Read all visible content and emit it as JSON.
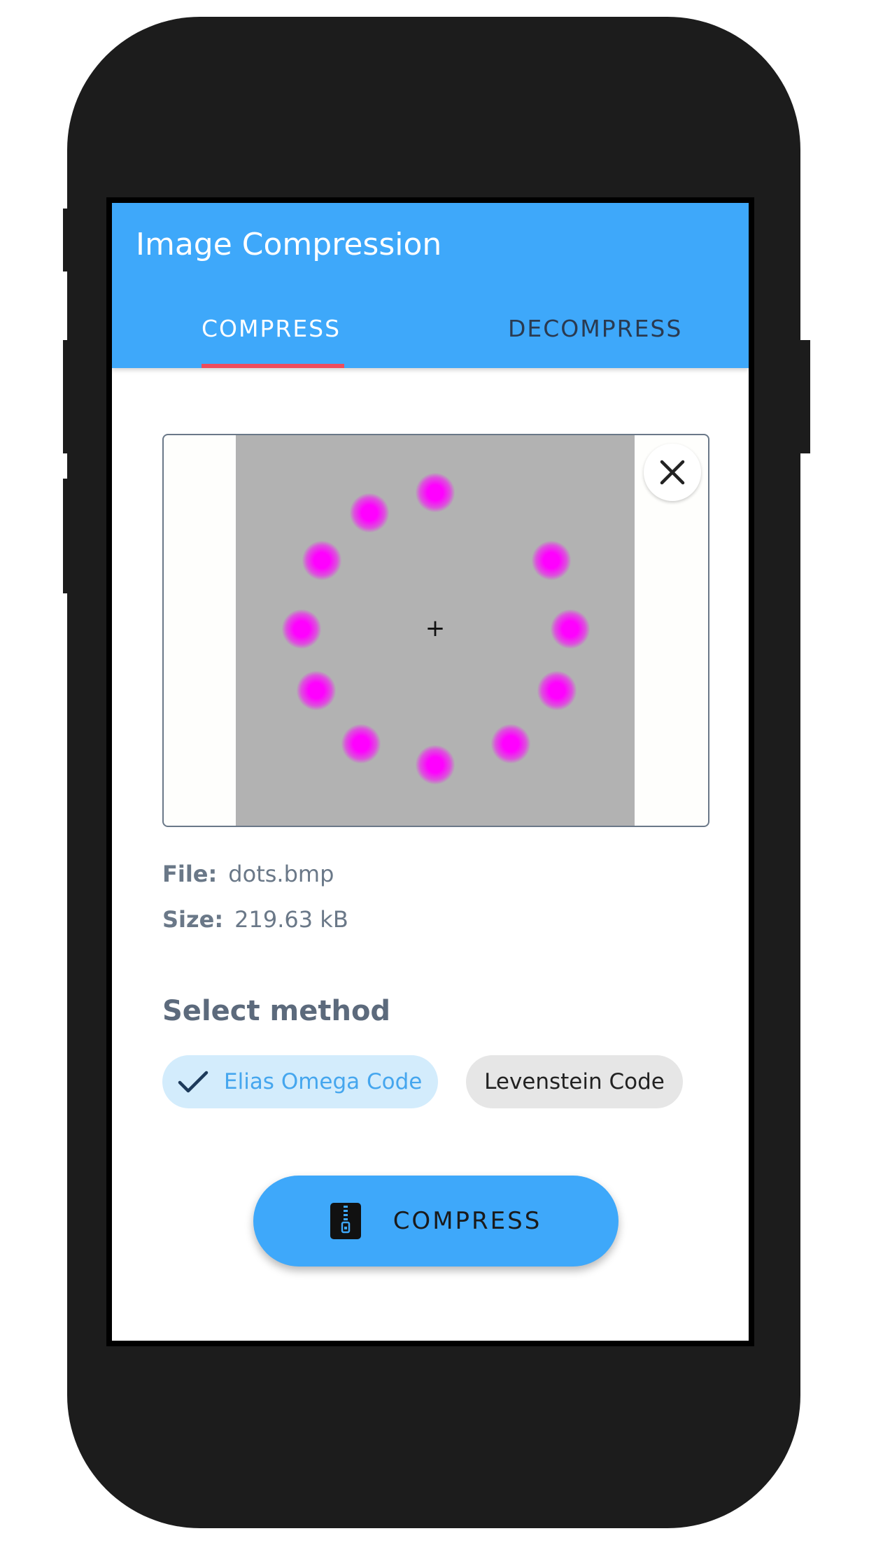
{
  "app": {
    "title": "Image Compression"
  },
  "tabs": [
    {
      "label": "COMPRESS",
      "selected": true
    },
    {
      "label": "DECOMPRESS",
      "selected": false
    }
  ],
  "file_info": {
    "file_label": "File:",
    "file_name": "dots.bmp",
    "size_label": "Size:",
    "size_value": "219.63 kB"
  },
  "method": {
    "title": "Select method",
    "options": [
      {
        "label": "Elias Omega Code",
        "selected": true
      },
      {
        "label": "Levenstein Code",
        "selected": false
      }
    ]
  },
  "action": {
    "compress_label": "COMPRESS",
    "icon": "zip-file-icon"
  },
  "icons": {
    "close": "close-icon",
    "check": "check-icon"
  },
  "colors": {
    "primary": "#3ea8fa",
    "tab_indicator": "#ee4c5c",
    "selected_chip_bg": "#d3ecfc",
    "selected_chip_text": "#45a6ee",
    "dot": "#ff00ff"
  }
}
